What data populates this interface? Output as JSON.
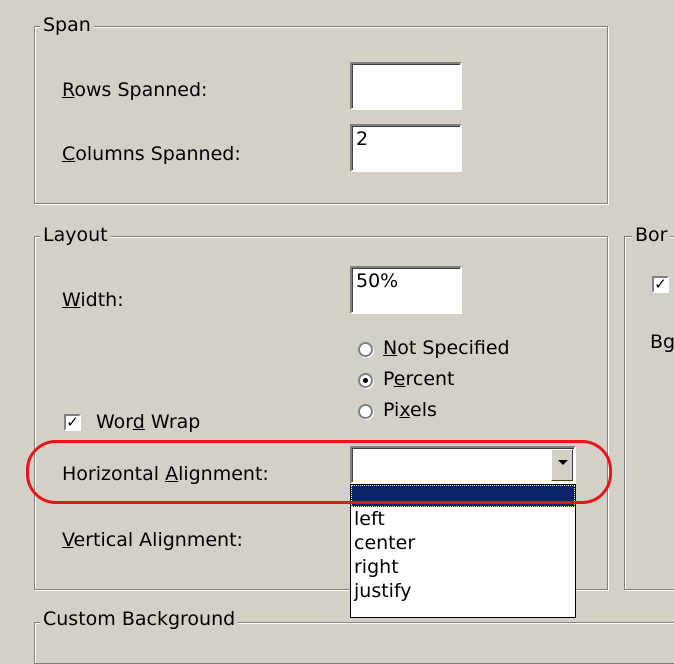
{
  "span": {
    "legend": "Span",
    "rows_label": "Rows Spanned:",
    "rows_value": "",
    "columns_label": "Columns Spanned:",
    "columns_value": "2"
  },
  "layout": {
    "legend": "Layout",
    "width_label": "Width:",
    "width_value": "50%",
    "radios": [
      {
        "label": "Not Specified",
        "checked": false
      },
      {
        "label": "Percent",
        "checked": true
      },
      {
        "label": "Pixels",
        "checked": false
      }
    ],
    "word_wrap_label": "Word Wrap",
    "word_wrap_checked": true,
    "halign_label": "Horizontal Alignment:",
    "halign_value": "",
    "valign_label": "Vertical Alignment:",
    "halign_options": [
      "",
      "left",
      "center",
      "right",
      "justify"
    ]
  },
  "borders": {
    "legend": "Bor",
    "checkbox_checked": true,
    "label_partial": "Bg"
  },
  "custom_background": {
    "legend": "Custom Background"
  },
  "colors": {
    "highlight": "#e8141a",
    "selection": "#0a246a"
  }
}
